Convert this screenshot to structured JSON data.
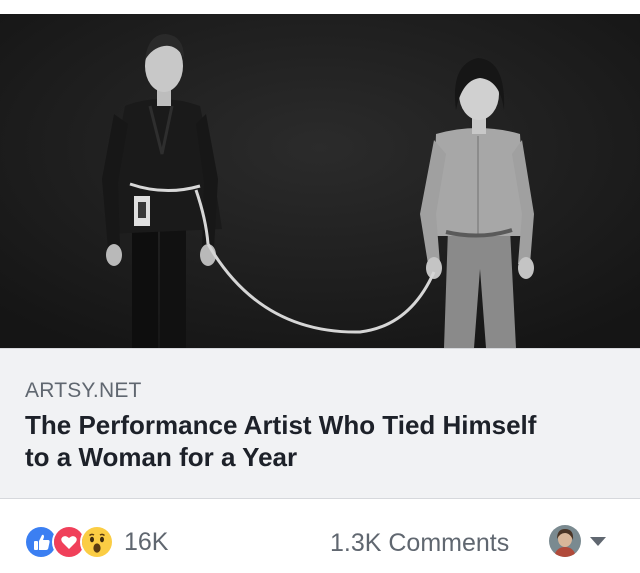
{
  "link_preview": {
    "image_description_name": "photo-two-people-tied-with-rope",
    "domain": "ARTSY.NET",
    "title_lines": [
      "The Performance Artist Who Tied Himself",
      "to a Woman for a Year"
    ]
  },
  "footer": {
    "reactions": {
      "icons": [
        "like-icon",
        "love-icon",
        "wow-icon"
      ],
      "count": "16K"
    },
    "comments_label": "1.3K Comments",
    "colors": {
      "like": "#3b7ff2",
      "love": "#f0405a",
      "wow": "#fbcd44",
      "muted_text": "#606770"
    }
  }
}
